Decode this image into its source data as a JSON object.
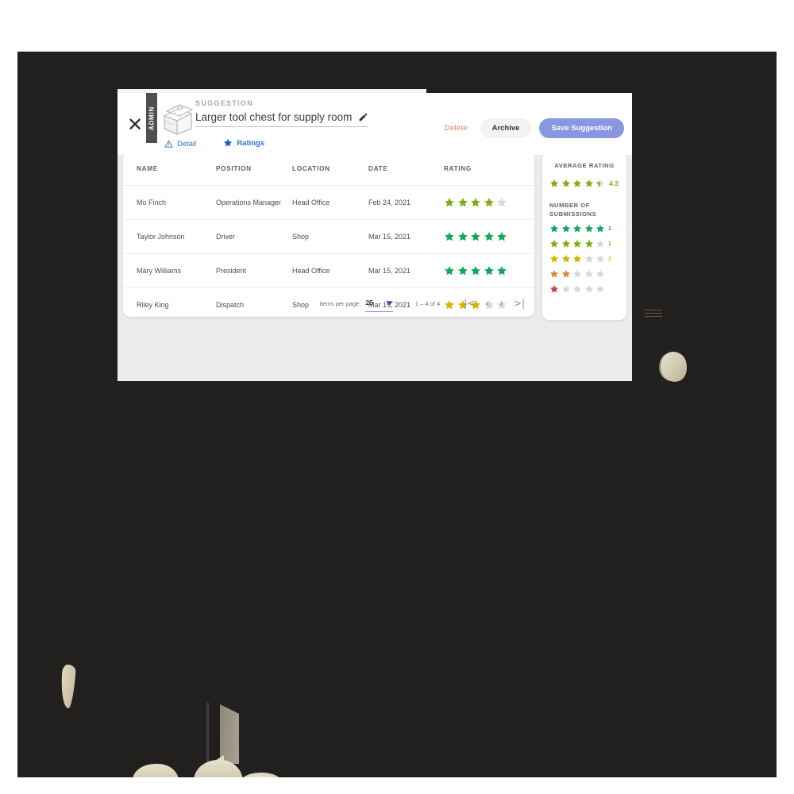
{
  "window": {
    "close_icon": "close-icon",
    "admin_tab_label": "ADMIN",
    "suggestion_icon": "suggestion-box-icon"
  },
  "header": {
    "kicker": "SUGGESTION",
    "title": "Larger tool chest for supply room",
    "edit_icon": "pencil-icon",
    "actions": {
      "delete_label": "Delete",
      "archive_label": "Archive",
      "save_label": "Save Suggestion"
    }
  },
  "tabs": [
    {
      "label": "Detail",
      "icon": "warning-triangle-icon",
      "active": false
    },
    {
      "label": "Ratings",
      "icon": "star-icon",
      "active": true
    }
  ],
  "table": {
    "columns": [
      "NAME",
      "POSITION",
      "LOCATION",
      "DATE",
      "RATING"
    ],
    "rows": [
      {
        "name": "Mo Finch",
        "position": "Operations Manager",
        "location": "Head Office",
        "date": "Feb 24, 2021",
        "rating": 4,
        "rating_color": "#7fae18"
      },
      {
        "name": "Taylor Johnson",
        "position": "Driver",
        "location": "Shop",
        "date": "Mar 15, 2021",
        "rating": 5,
        "rating_color": "#12a75c"
      },
      {
        "name": "Mary Williams",
        "position": "President",
        "location": "Head Office",
        "date": "Mar 15, 2021",
        "rating": 5,
        "rating_color": "#12a75c"
      },
      {
        "name": "Riley King",
        "position": "Dispatch",
        "location": "Shop",
        "date": "Mar 15, 2021",
        "rating": 3,
        "rating_color": "#d8b300"
      }
    ]
  },
  "paginator": {
    "items_per_page_label": "Items per page:",
    "items_per_page_value": "25",
    "dropdown_icon": "chevron-down-icon",
    "range_label": "1 – 4 of 4",
    "first_page_icon": "|<",
    "prev_page_icon": "‹",
    "next_page_icon": "›",
    "last_page_icon": ">|"
  },
  "summary": {
    "average_label": "AVERAGE RATING",
    "average_value": "4.3",
    "average_stars": 4,
    "average_half": true,
    "average_color": "#84ad15",
    "submissions_label": "NUMBER OF SUBMISSIONS",
    "distribution": [
      {
        "stars": 5,
        "count": "1",
        "color": "#12a75c"
      },
      {
        "stars": 4,
        "count": "1",
        "color": "#7fae18"
      },
      {
        "stars": 3,
        "count": "1",
        "color": "#d8b300"
      },
      {
        "stars": 2,
        "count": "",
        "color": "#d98f2b"
      },
      {
        "stars": 1,
        "count": "",
        "color": "#cf3f4a"
      }
    ]
  },
  "colors": {
    "viewport_background": "#221f1f",
    "page_background": "#ececec",
    "card_background": "#ffffff",
    "accent_blue": "#2f6fd0",
    "save_button": "#8897e0",
    "delete_text": "#e8756f",
    "star_empty": "#d8d8d8",
    "mesh_beige": "#ded7c0"
  }
}
